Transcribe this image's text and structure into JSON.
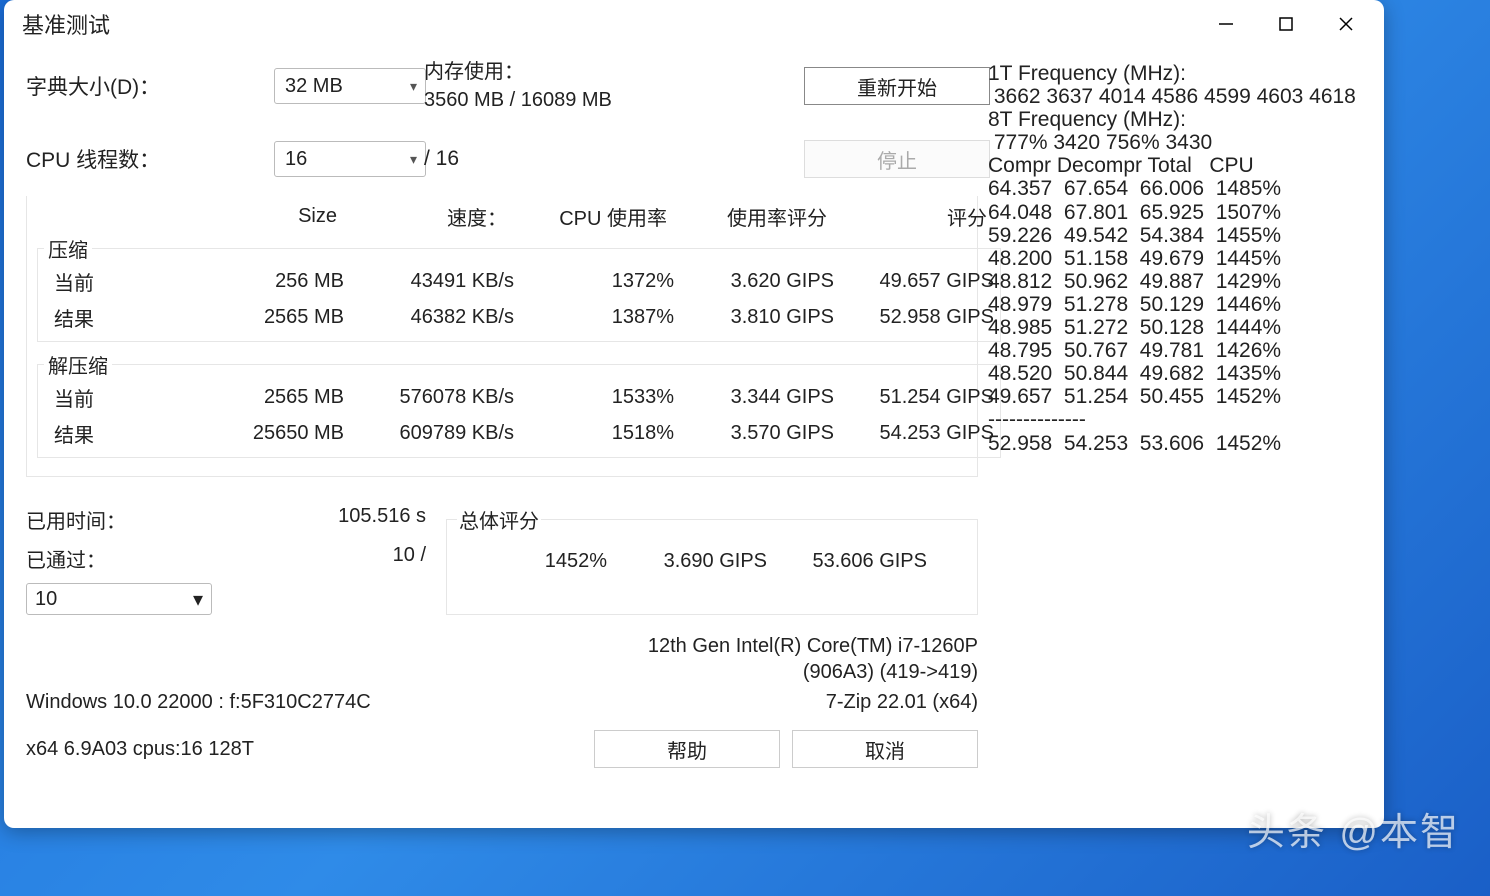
{
  "window": {
    "title": "基准测试"
  },
  "config": {
    "dict_label": "字典大小(D)：",
    "dict_value": "32 MB",
    "threads_label": "CPU 线程数：",
    "threads_value": "16",
    "threads_total": "/ 16",
    "mem_label": "内存使用：",
    "mem_value": "3560 MB / 16089 MB",
    "restart_btn": "重新开始",
    "stop_btn": "停止"
  },
  "headers": {
    "size": "Size",
    "speed": "速度：",
    "cpu_usage": "CPU 使用率",
    "usage_rating": "使用率评分",
    "rating": "评分"
  },
  "compress": {
    "legend": "压缩",
    "current_label": "当前",
    "current": {
      "size": "256 MB",
      "speed": "43491 KB/s",
      "cpu": "1372%",
      "usage": "3.620 GIPS",
      "rating": "49.657 GIPS"
    },
    "result_label": "结果",
    "result": {
      "size": "2565 MB",
      "speed": "46382 KB/s",
      "cpu": "1387%",
      "usage": "3.810 GIPS",
      "rating": "52.958 GIPS"
    }
  },
  "decompress": {
    "legend": "解压缩",
    "current_label": "当前",
    "current": {
      "size": "2565 MB",
      "speed": "576078 KB/s",
      "cpu": "1533%",
      "usage": "3.344 GIPS",
      "rating": "51.254 GIPS"
    },
    "result_label": "结果",
    "result": {
      "size": "25650 MB",
      "speed": "609789 KB/s",
      "cpu": "1518%",
      "usage": "3.570 GIPS",
      "rating": "54.253 GIPS"
    }
  },
  "elapsed": {
    "label": "已用时间：",
    "value": "105.516 s"
  },
  "passes": {
    "label": "已通过：",
    "value": "10 /"
  },
  "passes_select": "10",
  "total": {
    "legend": "总体评分",
    "cpu": "1452%",
    "usage": "3.690 GIPS",
    "rating": "53.606 GIPS"
  },
  "cpu_info": {
    "line1": "12th Gen Intel(R) Core(TM) i7-1260P",
    "line2": "(906A3) (419->419)"
  },
  "sys": {
    "os": "Windows 10.0 22000 :  f:5F310C2774C",
    "sevenzip": "7-Zip 22.01 (x64)",
    "arch": "x64 6.9A03 cpus:16 128T"
  },
  "buttons": {
    "help": "帮助",
    "cancel": "取消"
  },
  "right_panel": "1T Frequency (MHz):\n 3662 3637 4014 4586 4599 4603 4618\n8T Frequency (MHz):\n 777% 3420 756% 3430\nCompr Decompr Total   CPU\n64.357  67.654  66.006  1485%\n64.048  67.801  65.925  1507%\n59.226  49.542  54.384  1455%\n48.200  51.158  49.679  1445%\n48.812  50.962  49.887  1429%\n48.979  51.278  50.129  1446%\n48.985  51.272  50.128  1444%\n48.795  50.767  49.781  1426%\n48.520  50.844  49.682  1435%\n49.657  51.254  50.455  1452%\n--------------\n52.958  54.253  53.606  1452%",
  "watermark": "头条 @本智"
}
